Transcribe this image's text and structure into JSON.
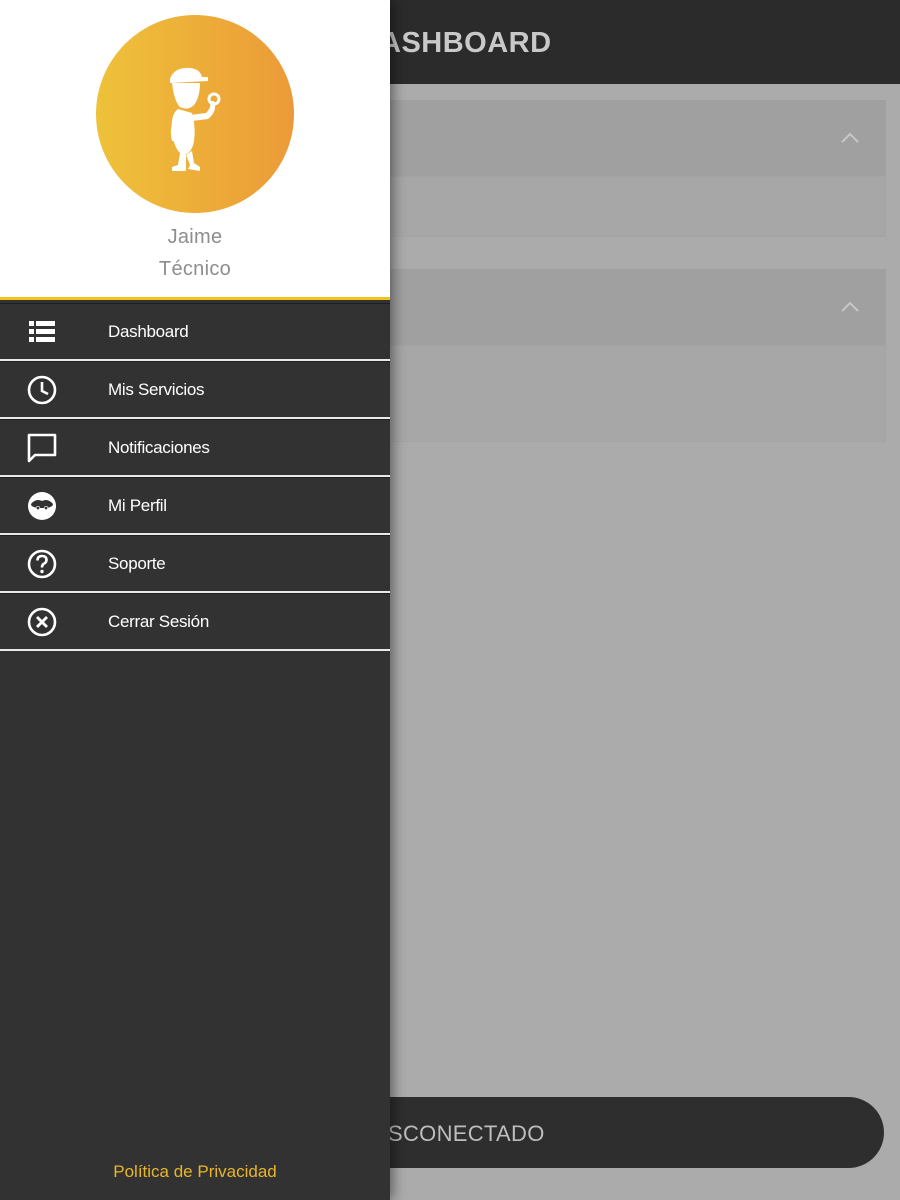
{
  "app": {
    "title": "DASHBOARD",
    "title_visible": "ASHBOARD",
    "status_text": "SCONECTADO"
  },
  "drawer": {
    "user": {
      "name": "Jaime",
      "role": "Técnico"
    },
    "menu": [
      {
        "label": "Dashboard",
        "icon": "list-icon"
      },
      {
        "label": "Mis Servicios",
        "icon": "clock-icon"
      },
      {
        "label": "Notificaciones",
        "icon": "chat-icon"
      },
      {
        "label": "Mi Perfil",
        "icon": "face-icon"
      },
      {
        "label": "Soporte",
        "icon": "help-icon"
      },
      {
        "label": "Cerrar Sesión",
        "icon": "close-circle-icon"
      }
    ],
    "footer_link": "Política de Privacidad"
  },
  "colors": {
    "accent": "#f2c21a",
    "drawer_bg": "#323232",
    "overlay_bg": "#ababab",
    "link": "#e9b52a"
  }
}
